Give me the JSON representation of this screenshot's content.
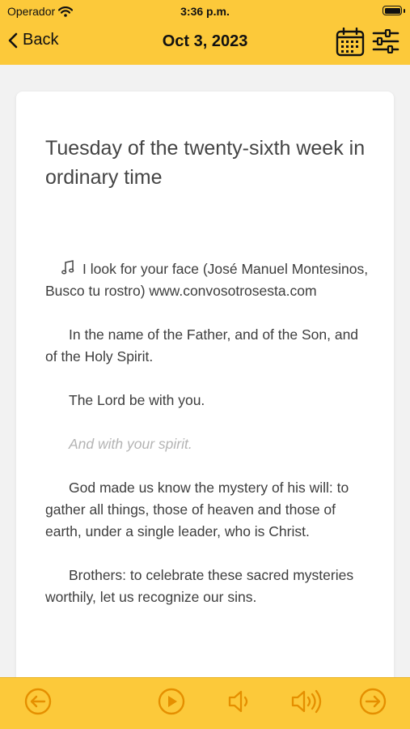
{
  "status_bar": {
    "carrier": "Operador",
    "time": "3:36 p.m."
  },
  "nav": {
    "back_label": "Back",
    "title": "Oct 3, 2023"
  },
  "reading": {
    "heading": "Tuesday of the twenty-sixth week in ordinary time",
    "music_line": "I look for your face (José Manuel Montesinos, Busco tu rostro) www.convosotrosesta.com",
    "paragraphs": [
      "In the name of the Father, and of the Son, and of the Holy Spirit.",
      "The Lord be with you.",
      "God made us know the mystery of his will: to gather all things, those of heaven and those of earth, under a single leader, who is Christ.",
      "Brothers: to celebrate these sacred mysteries worthily, let us recognize our sins."
    ],
    "response": "And with your spirit."
  },
  "toolbar": {
    "icons": [
      "arrow-left-circle-icon",
      "play-circle-icon",
      "volume-low-icon",
      "volume-high-icon",
      "arrow-right-circle-icon"
    ],
    "accent": "#fcc93a",
    "icon_color": "#e58f00"
  }
}
